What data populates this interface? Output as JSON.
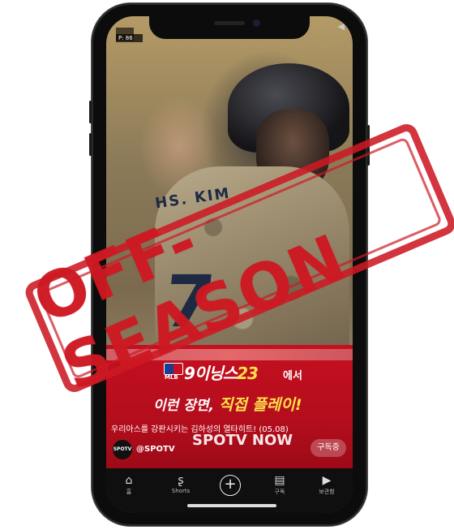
{
  "status": {
    "badge_top": "",
    "badge_label": "P: 86"
  },
  "video": {
    "jersey_name": "HS. KIM",
    "jersey_number": "7"
  },
  "ad": {
    "mlb_label": "MLB",
    "title": "9이닝스",
    "title_number": "23",
    "title_suffix": "에서",
    "line2_prefix": "이런 장면,",
    "line2_highlight": "직접 플레이!"
  },
  "caption": "우리아스를 강판시키는 김하성의 열타히트! (05.08)",
  "brand_watermark": "SPOTV NOW",
  "channel": {
    "avatar_text": "SPOTV",
    "handle": "@SPOTV",
    "subscribe_label": "구독중"
  },
  "nav": [
    {
      "icon": "home-icon",
      "label": "홈"
    },
    {
      "icon": "shorts-icon",
      "label": "Shorts"
    },
    {
      "icon": "create-icon",
      "label": ""
    },
    {
      "icon": "subscriptions-icon",
      "label": "구독"
    },
    {
      "icon": "library-icon",
      "label": "보관함"
    }
  ],
  "stamp": "OFF-SEASON",
  "colors": {
    "stamp_red": "#cd1923",
    "ad_red": "#c51020",
    "highlight_yellow": "#ffe04a"
  }
}
